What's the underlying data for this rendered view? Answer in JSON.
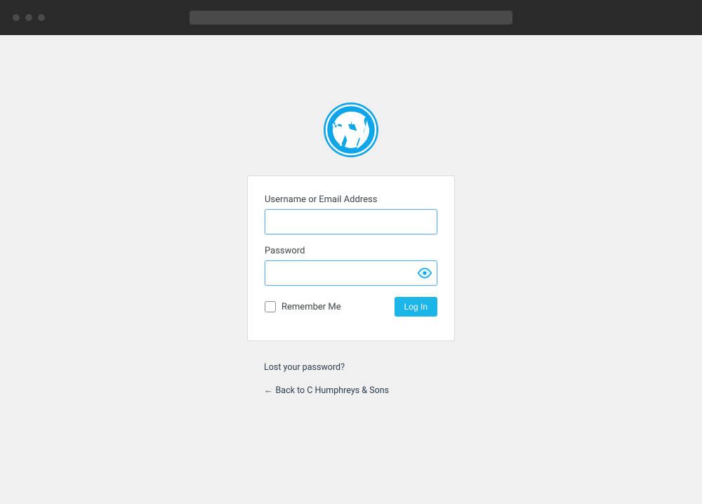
{
  "form": {
    "username_label": "Username or Email Address",
    "username_value": "",
    "password_label": "Password",
    "password_value": "",
    "remember_label": "Remember Me",
    "submit_label": "Log In"
  },
  "links": {
    "lost_password": "Lost your password?",
    "back_to_site": "Back to C Humphreys & Sons"
  },
  "colors": {
    "accent": "#1cb5e8",
    "logo": "#0ea5e9"
  }
}
